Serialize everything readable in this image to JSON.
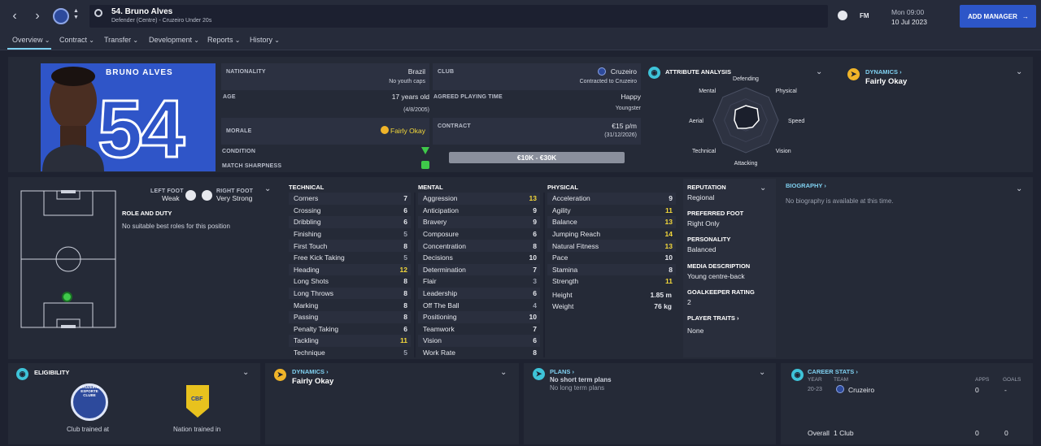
{
  "header": {
    "title": "54. Bruno Alves",
    "subtitle": "Defender (Centre) - Cruzeiro Under 20s",
    "fm_label": "FM",
    "day": "Mon 09:00",
    "date": "10 Jul 2023",
    "add_manager": "ADD MANAGER"
  },
  "tabs": [
    "Overview",
    "Contract",
    "Transfer",
    "Development",
    "Reports",
    "History"
  ],
  "profile": {
    "name": "BRUNO ALVES",
    "number": "54",
    "nationality_label": "NATIONALITY",
    "nationality": "Brazil",
    "youth_caps": "No youth caps",
    "club_label": "CLUB",
    "club": "Cruzeiro",
    "club_status": "Contracted to Cruzeiro",
    "age_label": "AGE",
    "age": "17 years old",
    "dob": "(4/8/2005)",
    "playing_time_label": "AGREED PLAYING TIME",
    "playing_time": "Happy",
    "playing_time_sub": "Youngster",
    "morale_label": "MORALE",
    "morale": "Fairly Okay",
    "contract_label": "CONTRACT",
    "wage": "€15 p/m",
    "contract_end": "(31/12/2026)",
    "condition_label": "CONDITION",
    "sharpness_label": "MATCH SHARPNESS",
    "value_range": "€10K - €30K"
  },
  "analysis": {
    "title": "ATTRIBUTE ANALYSIS",
    "labels": [
      "Defending",
      "Physical",
      "Speed",
      "Vision",
      "Attacking",
      "Technical",
      "Aerial",
      "Mental"
    ],
    "values": [
      0.45,
      0.5,
      0.4,
      0.3,
      0.25,
      0.35,
      0.35,
      0.45
    ]
  },
  "dynamics_top": {
    "title": "DYNAMICS",
    "value": "Fairly Okay"
  },
  "feet": {
    "left_label": "LEFT FOOT",
    "left": "Weak",
    "right_label": "RIGHT FOOT",
    "right": "Very Strong",
    "role_title": "ROLE AND DUTY",
    "role_text": "No suitable best roles for this position"
  },
  "technical": {
    "title": "TECHNICAL",
    "rows": [
      {
        "name": "Corners",
        "value": "7",
        "tone": "w"
      },
      {
        "name": "Crossing",
        "value": "6",
        "tone": "w"
      },
      {
        "name": "Dribbling",
        "value": "6",
        "tone": "w"
      },
      {
        "name": "Finishing",
        "value": "5",
        "tone": "g"
      },
      {
        "name": "First Touch",
        "value": "8",
        "tone": "w"
      },
      {
        "name": "Free Kick Taking",
        "value": "5",
        "tone": "g"
      },
      {
        "name": "Heading",
        "value": "12",
        "tone": "y"
      },
      {
        "name": "Long Shots",
        "value": "8",
        "tone": "w"
      },
      {
        "name": "Long Throws",
        "value": "8",
        "tone": "w"
      },
      {
        "name": "Marking",
        "value": "8",
        "tone": "w"
      },
      {
        "name": "Passing",
        "value": "8",
        "tone": "w"
      },
      {
        "name": "Penalty Taking",
        "value": "6",
        "tone": "w"
      },
      {
        "name": "Tackling",
        "value": "11",
        "tone": "y"
      },
      {
        "name": "Technique",
        "value": "5",
        "tone": "g"
      }
    ]
  },
  "mental": {
    "title": "MENTAL",
    "rows": [
      {
        "name": "Aggression",
        "value": "13",
        "tone": "y"
      },
      {
        "name": "Anticipation",
        "value": "9",
        "tone": "w"
      },
      {
        "name": "Bravery",
        "value": "9",
        "tone": "w"
      },
      {
        "name": "Composure",
        "value": "6",
        "tone": "w"
      },
      {
        "name": "Concentration",
        "value": "8",
        "tone": "w"
      },
      {
        "name": "Decisions",
        "value": "10",
        "tone": "w"
      },
      {
        "name": "Determination",
        "value": "7",
        "tone": "w"
      },
      {
        "name": "Flair",
        "value": "3",
        "tone": "g"
      },
      {
        "name": "Leadership",
        "value": "6",
        "tone": "w"
      },
      {
        "name": "Off The Ball",
        "value": "4",
        "tone": "g"
      },
      {
        "name": "Positioning",
        "value": "10",
        "tone": "w"
      },
      {
        "name": "Teamwork",
        "value": "7",
        "tone": "w"
      },
      {
        "name": "Vision",
        "value": "6",
        "tone": "w"
      },
      {
        "name": "Work Rate",
        "value": "8",
        "tone": "w"
      }
    ]
  },
  "physical": {
    "title": "PHYSICAL",
    "rows": [
      {
        "name": "Acceleration",
        "value": "9",
        "tone": "w"
      },
      {
        "name": "Agility",
        "value": "11",
        "tone": "y"
      },
      {
        "name": "Balance",
        "value": "13",
        "tone": "y"
      },
      {
        "name": "Jumping Reach",
        "value": "14",
        "tone": "y"
      },
      {
        "name": "Natural Fitness",
        "value": "13",
        "tone": "y"
      },
      {
        "name": "Pace",
        "value": "10",
        "tone": "w"
      },
      {
        "name": "Stamina",
        "value": "8",
        "tone": "w"
      },
      {
        "name": "Strength",
        "value": "11",
        "tone": "y"
      }
    ],
    "height_label": "Height",
    "height": "1.85 m",
    "weight_label": "Weight",
    "weight": "76 kg"
  },
  "info": {
    "reputation_label": "REPUTATION",
    "reputation": "Regional",
    "foot_label": "PREFERRED FOOT",
    "foot": "Right Only",
    "personality_label": "PERSONALITY",
    "personality": "Balanced",
    "media_label": "MEDIA DESCRIPTION",
    "media": "Young centre-back",
    "gk_label": "GOALKEEPER RATING",
    "gk": "2",
    "traits_label": "PLAYER TRAITS",
    "traits": "None"
  },
  "biography": {
    "title": "BIOGRAPHY",
    "text": "No biography is available at this time."
  },
  "eligibility": {
    "title": "ELIGIBILITY",
    "club_trained": "Club trained at",
    "nation_trained": "Nation trained in",
    "club_badge_text": "CRUZEIRO ESPORTE CLUBE",
    "nation_badge_text": "CBF"
  },
  "dynamics_bottom": {
    "title": "DYNAMICS",
    "value": "Fairly Okay"
  },
  "plans": {
    "title": "PLANS",
    "short": "No short term plans",
    "long": "No long term plans"
  },
  "career": {
    "title": "CAREER STATS",
    "col_year": "YEAR",
    "col_team": "TEAM",
    "col_apps": "APPS",
    "col_goals": "GOALS",
    "row_year": "20-23",
    "row_team": "Cruzeiro",
    "row_apps": "0",
    "row_goals": "-",
    "overall_label": "Overall",
    "overall_clubs": "1 Club",
    "overall_apps": "0",
    "overall_goals": "0"
  },
  "colors": {
    "accent": "#2d56c8",
    "yellow": "#f5d93a",
    "cyan": "#3ec3d8",
    "green": "#3fc94a"
  }
}
